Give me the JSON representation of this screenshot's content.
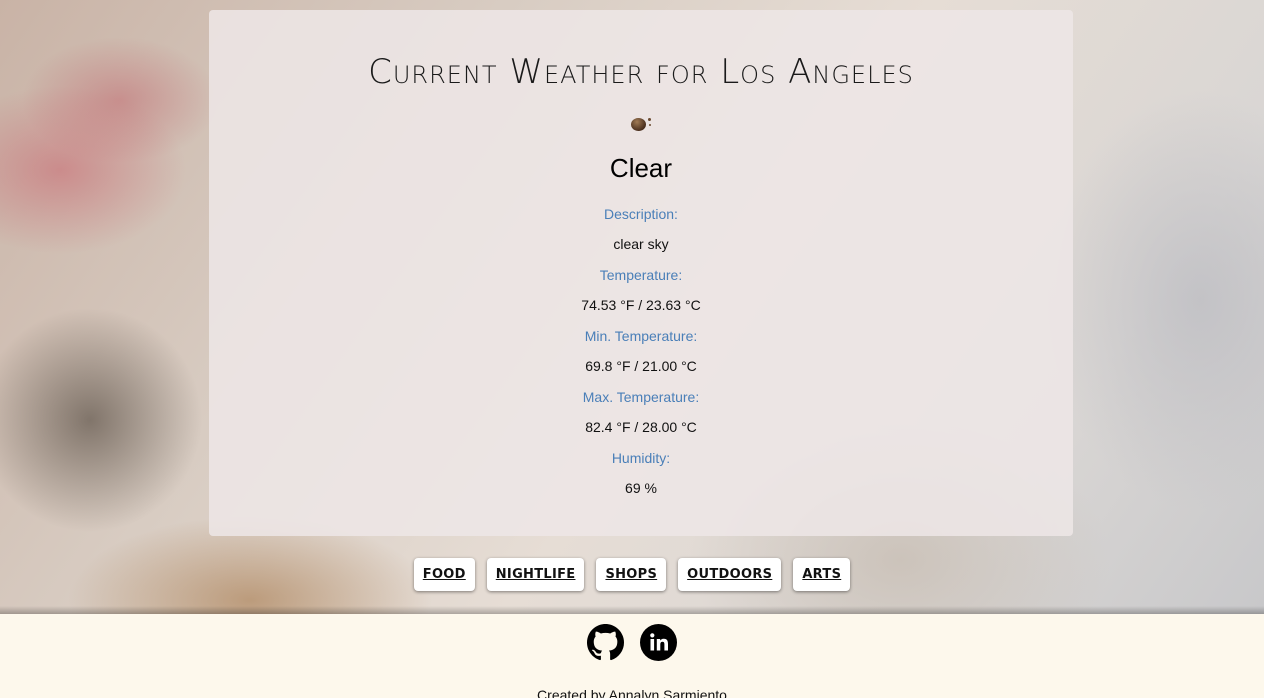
{
  "weather": {
    "title": "Current Weather for Los Angeles",
    "icon": "clear-sky-icon",
    "main": "Clear",
    "details": [
      {
        "label": "Description:",
        "value": "clear sky"
      },
      {
        "label": "Temperature:",
        "value": "74.53 °F / 23.63 °C"
      },
      {
        "label": "Min. Temperature:",
        "value": "69.8 °F / 21.00 °C"
      },
      {
        "label": "Max. Temperature:",
        "value": "82.4 °F / 28.00 °C"
      },
      {
        "label": "Humidity:",
        "value": "69 %"
      }
    ]
  },
  "categories": [
    {
      "label": "FOOD"
    },
    {
      "label": "NIGHTLIFE"
    },
    {
      "label": "SHOPS"
    },
    {
      "label": "OUTDOORS"
    },
    {
      "label": "ARTS"
    }
  ],
  "footer": {
    "social_icons": [
      "github-icon",
      "linkedin-icon"
    ],
    "credit": "Created by Annalyn Sarmiento"
  },
  "colors": {
    "label_blue": "#4a7fb8",
    "footer_bg": "#fdf8ec",
    "card_bg": "#eee6e6"
  }
}
